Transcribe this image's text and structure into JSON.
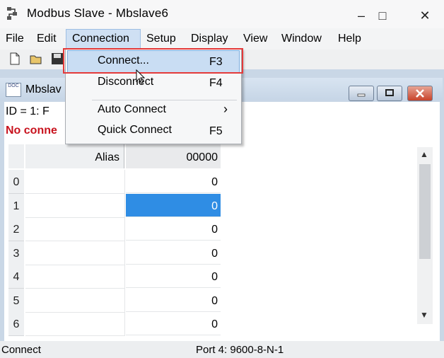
{
  "window": {
    "title": "Modbus Slave - Mbslave6",
    "minimize": "–",
    "maximize": "□",
    "close": "✕"
  },
  "menubar": [
    "File",
    "Edit",
    "Connection",
    "Setup",
    "Display",
    "View",
    "Window",
    "Help"
  ],
  "toolbar": {
    "icons": [
      "new-document-icon",
      "open-folder-icon",
      "save-icon"
    ]
  },
  "child_window": {
    "title": "Mbslav",
    "icon_text": "DOC",
    "id_line": "ID = 1: F",
    "status_line": "No conne"
  },
  "grid": {
    "alias_header": "Alias",
    "column_header": "00000",
    "rows": [
      {
        "index": "0",
        "value": "0"
      },
      {
        "index": "1",
        "value": "0"
      },
      {
        "index": "2",
        "value": "0"
      },
      {
        "index": "3",
        "value": "0"
      },
      {
        "index": "4",
        "value": "0"
      },
      {
        "index": "5",
        "value": "0"
      },
      {
        "index": "6",
        "value": "0"
      }
    ],
    "selected_row": "1"
  },
  "connection_menu": {
    "items": [
      {
        "label": "Connect...",
        "shortcut": "F3",
        "highlighted": true
      },
      {
        "label": "Disconnect",
        "shortcut": "F4"
      },
      {
        "label": "Auto Connect",
        "shortcut": "›"
      },
      {
        "label": "Quick Connect",
        "shortcut": "F5"
      }
    ]
  },
  "statusbar": {
    "left": "Connect",
    "port": "Port 4: 9600-8-N-1"
  },
  "colors": {
    "selection": "#2f8de4",
    "no_connection": "#c8131e",
    "annotation_box": "#e43a3a"
  }
}
